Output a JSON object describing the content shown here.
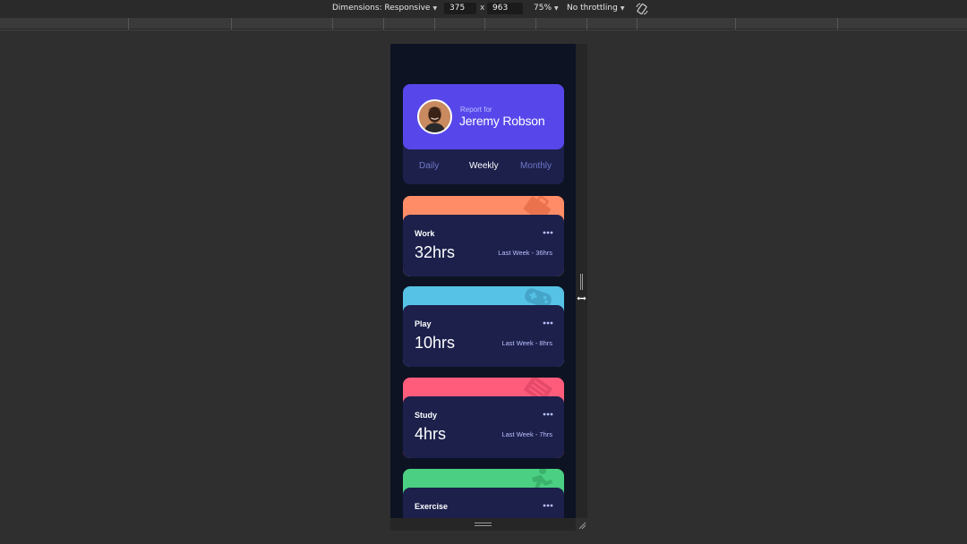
{
  "devtools": {
    "dimensions_label": "Dimensions: Responsive",
    "width": "375",
    "separator": "x",
    "height": "963",
    "zoom": "75%",
    "throttling": "No throttling",
    "rotate_icon": "rotate-icon"
  },
  "profile": {
    "report_for": "Report for",
    "name": "Jeremy Robson",
    "avatar_icon": "avatar-photo"
  },
  "tabs": [
    {
      "label": "Daily",
      "active": false
    },
    {
      "label": "Weekly",
      "active": true
    },
    {
      "label": "Monthly",
      "active": false
    }
  ],
  "cards": [
    {
      "title": "Work",
      "hours": "32hrs",
      "previous": "Last Week - 36hrs",
      "color": "#ff8c66",
      "icon": "briefcase-icon"
    },
    {
      "title": "Play",
      "hours": "10hrs",
      "previous": "Last Week - 8hrs",
      "color": "#56c2e6",
      "icon": "gamepad-icon"
    },
    {
      "title": "Study",
      "hours": "4hrs",
      "previous": "Last Week - 7hrs",
      "color": "#ff5c7c",
      "icon": "book-icon"
    },
    {
      "title": "Exercise",
      "hours": "",
      "previous": "",
      "color": "#4bcf82",
      "icon": "runner-icon"
    }
  ],
  "colors": {
    "page_bg": "#0d1323",
    "card_bg": "#1c204b",
    "accent": "#5747ea",
    "muted_text": "#bbc0ff"
  }
}
